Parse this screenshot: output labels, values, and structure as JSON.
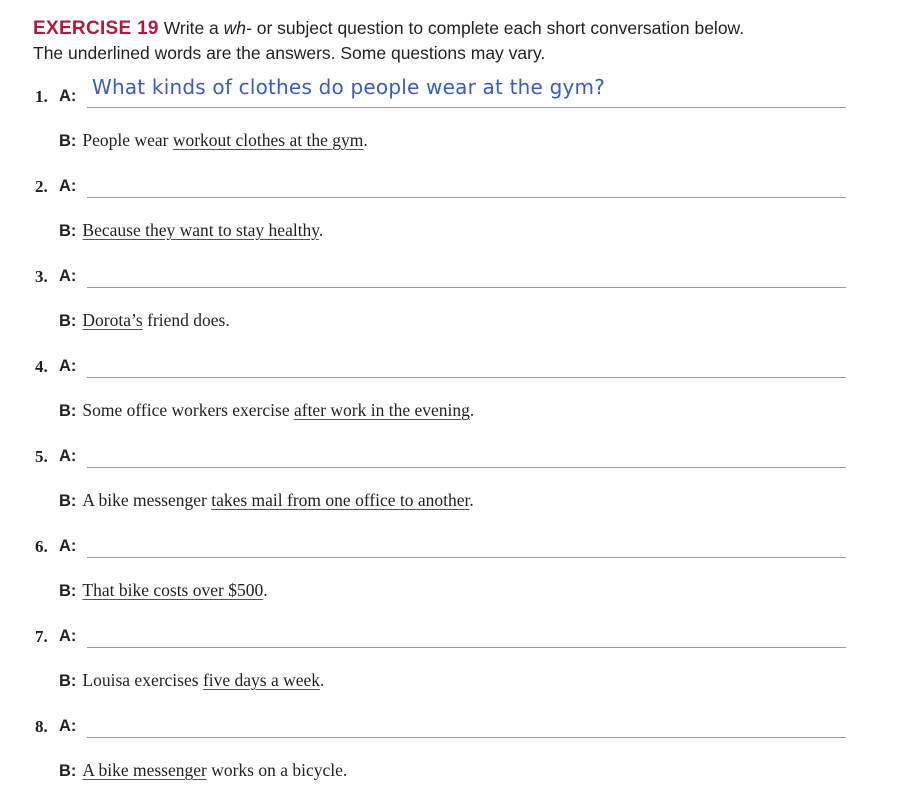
{
  "header": {
    "exercise_label": "EXERCISE 19",
    "instr_1": "Write a ",
    "instr_wh": "wh-",
    "instr_2": " or subject question to complete each short conversation below.",
    "instr_line2": "The underlined words are the answers. Some questions may vary."
  },
  "colors": {
    "exercise_label": "#b01b3c",
    "handwriting": "#3a5bbf"
  },
  "a_label": "A:",
  "b_label": "B:",
  "items": [
    {
      "num": "1.",
      "answer": "What kinds of clothes do people wear at the gym?",
      "b_parts": [
        {
          "t": "People wear ",
          "u": false
        },
        {
          "t": "workout clothes at the gym",
          "u": true
        },
        {
          "t": ".",
          "u": false
        }
      ]
    },
    {
      "num": "2.",
      "answer": "",
      "b_parts": [
        {
          "t": "Because they want to stay healthy",
          "u": true
        },
        {
          "t": ".",
          "u": false
        }
      ]
    },
    {
      "num": "3.",
      "answer": "",
      "b_parts": [
        {
          "t": "Dorota’s",
          "u": true
        },
        {
          "t": " friend does.",
          "u": false
        }
      ]
    },
    {
      "num": "4.",
      "answer": "",
      "b_parts": [
        {
          "t": "Some office workers exercise ",
          "u": false
        },
        {
          "t": "after work in the evening",
          "u": true
        },
        {
          "t": ".",
          "u": false
        }
      ]
    },
    {
      "num": "5.",
      "answer": "",
      "b_parts": [
        {
          "t": "A bike messenger ",
          "u": false
        },
        {
          "t": "takes mail from one office to another",
          "u": true
        },
        {
          "t": ".",
          "u": false
        }
      ]
    },
    {
      "num": "6.",
      "answer": "",
      "b_parts": [
        {
          "t": "That bike costs over $500",
          "u": true
        },
        {
          "t": ".",
          "u": false
        }
      ]
    },
    {
      "num": "7.",
      "answer": "",
      "b_parts": [
        {
          "t": "Louisa exercises ",
          "u": false
        },
        {
          "t": "five days a week",
          "u": true
        },
        {
          "t": ".",
          "u": false
        }
      ]
    },
    {
      "num": "8.",
      "answer": "",
      "b_parts": [
        {
          "t": "A bike messenger",
          "u": true
        },
        {
          "t": " works on a bicycle.",
          "u": false
        }
      ]
    }
  ]
}
